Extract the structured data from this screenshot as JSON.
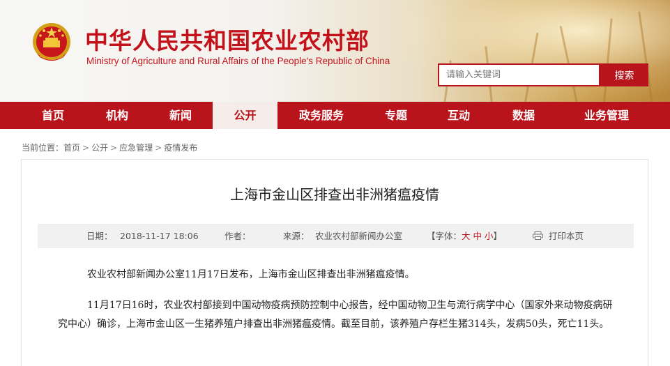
{
  "header": {
    "title": "中华人民共和国农业农村部",
    "subtitle": "Ministry of Agriculture and Rural Affairs of the People's Republic of China",
    "emblem_icon": "national-emblem-icon",
    "search_placeholder": "请输入关键词",
    "search_button": "搜索"
  },
  "nav": {
    "items": [
      "首页",
      "机构",
      "新闻",
      "公开",
      "政务服务",
      "专题",
      "互动",
      "数据",
      "业务管理"
    ],
    "active_index": 3
  },
  "breadcrumb": {
    "prefix": "当前位置：",
    "items": [
      "首页",
      "公开",
      "应急管理",
      "疫情发布"
    ],
    "separator": ">"
  },
  "article": {
    "title": "上海市金山区排查出非洲猪瘟疫情",
    "meta": {
      "date_label": "日期：",
      "date_value": "2018-11-17 18:06",
      "author_label": "作者：",
      "author_value": "",
      "source_label": "来源：",
      "source_value": "农业农村部新闻办公室",
      "font_open": "【字体：",
      "font_large": "大",
      "font_medium": "中",
      "font_small": "小",
      "font_close": "】",
      "print_label": "打印本页",
      "print_icon": "printer-icon"
    },
    "paragraphs": [
      "农业农村部新闻办公室11月17日发布，上海市金山区排查出非洲猪瘟疫情。",
      "11月17日16时，农业农村部接到中国动物疫病预防控制中心报告，经中国动物卫生与流行病学中心（国家外来动物疫病研究中心）确诊，上海市金山区一生猪养殖户排查出非洲猪瘟疫情。截至目前，该养殖户存栏生猪314头，发病50头，死亡11头。"
    ]
  },
  "colors": {
    "brand_red": "#b9141c",
    "title_red": "#c4121b",
    "meta_bg": "#f1f1f1"
  }
}
